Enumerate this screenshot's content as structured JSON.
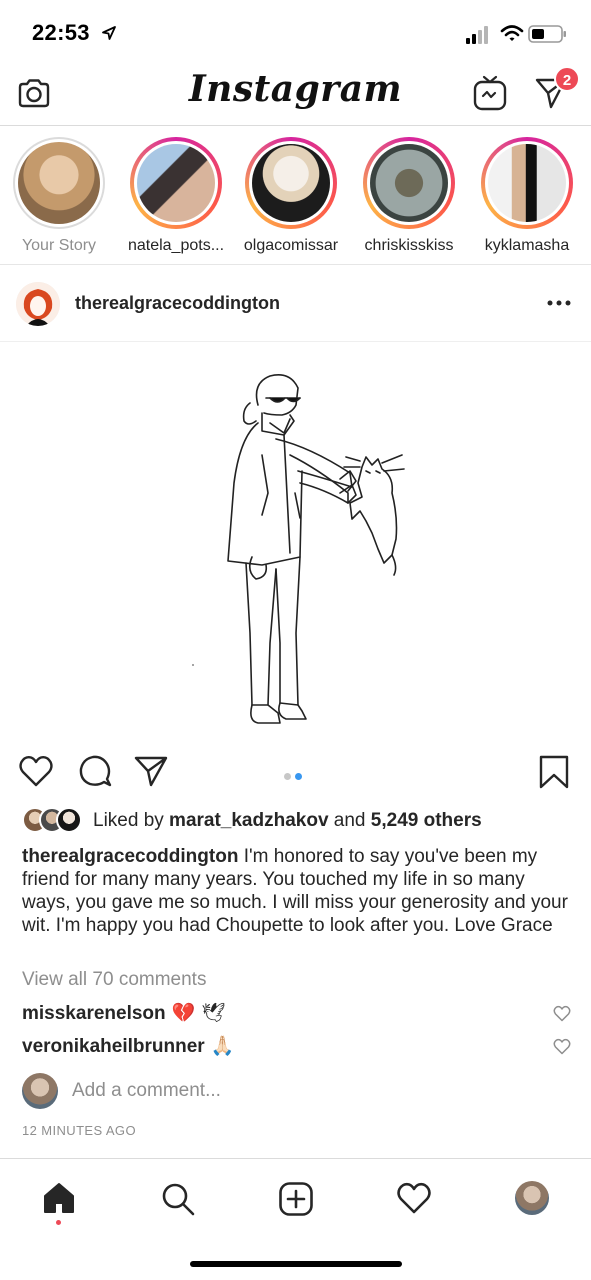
{
  "status_bar": {
    "time": "22:53"
  },
  "app": {
    "logo": "Instagram",
    "unread_badge": "2"
  },
  "stories": [
    {
      "username": "Your Story",
      "own": true
    },
    {
      "username": "natela_pots..."
    },
    {
      "username": "olgacomissar"
    },
    {
      "username": "chriskisskiss"
    },
    {
      "username": "kyklamasha"
    }
  ],
  "post": {
    "author": "therealgracecoddington",
    "carousel": {
      "count": 2,
      "active": 2
    },
    "liked_by_prefix": "Liked by ",
    "liked_by_user": "marat_kadzhakov",
    "liked_by_and": " and ",
    "liked_by_others": "5,249 others",
    "caption_user": "therealgracecoddington",
    "caption_text": " I'm honored to say you've been my friend for many many years. You touched my life in so many ways, you gave me so much. I will miss your generosity and your wit. I'm happy you had Choupette to look after you. Love Grace",
    "view_all_comments": "View all 70 comments",
    "comments": [
      {
        "user": "misskarenelson",
        "text": "💔 🕊"
      },
      {
        "user": "veronikaheilbrunner",
        "text": "🙏🏻"
      }
    ],
    "add_comment_placeholder": "Add a comment...",
    "timestamp": "12 MINUTES AGO"
  },
  "icons": {
    "status": [
      "location-arrow-icon",
      "signal-icon",
      "wifi-icon",
      "battery-icon"
    ],
    "top_nav": [
      "camera-icon",
      "igtv-icon",
      "direct-message-icon"
    ],
    "post": [
      "more-icon",
      "heart-icon",
      "comment-icon",
      "share-icon",
      "bookmark-icon"
    ],
    "tabs": [
      "home-icon",
      "search-icon",
      "add-icon",
      "activity-heart-icon",
      "profile-avatar"
    ]
  },
  "colors": {
    "badge": "#ed4956",
    "carousel_active": "#3897f0",
    "muted_text": "#8e8e8e",
    "text": "#262626"
  }
}
